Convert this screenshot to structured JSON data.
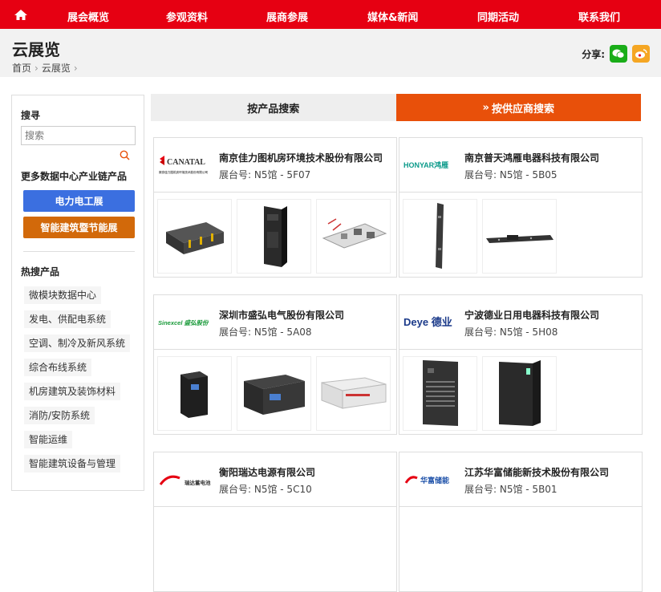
{
  "nav": {
    "items": [
      "展会概览",
      "参观资料",
      "展商参展",
      "媒体&新闻",
      "同期活动",
      "联系我们"
    ]
  },
  "header": {
    "title": "云展览",
    "breadcrumb": [
      "首页",
      "云展览"
    ],
    "share_label": "分享:"
  },
  "sidebar": {
    "search_title": "搜寻",
    "search_placeholder": "搜索",
    "more_title": "更多数据中心产业链产品",
    "buttons": [
      {
        "label": "电力电工展",
        "color": "#3b6fe0"
      },
      {
        "label": "智能建筑暨节能展",
        "color": "#d2690a"
      }
    ],
    "hot_title": "热搜产品",
    "hot_items": [
      "微模块数据中心",
      "发电、供配电系统",
      "空调、制冷及新风系统",
      "综合布线系统",
      "机房建筑及装饰材料",
      "消防/安防系统",
      "智能运维",
      "智能建筑设备与管理"
    ]
  },
  "tabs": {
    "product": "按产品搜索",
    "supplier": "按供应商搜索",
    "supplier_icon": "»"
  },
  "colors": {
    "brand_red": "#e60012",
    "active_tab": "#e8500a"
  },
  "exhibitors": [
    {
      "name": "南京佳力图机房环境技术股份有限公司",
      "booth": "展台号: N5馆 - 5F07",
      "logo": "CANATAL",
      "logo_sub": "南京佳力图机房环境技术股份有限公司"
    },
    {
      "name": "南京普天鸿雁电器科技有限公司",
      "booth": "展台号: N5馆 - 5B05",
      "logo": "HONYAR鸿雁"
    },
    {
      "name": "深圳市盛弘电气股份有限公司",
      "booth": "展台号: N5馆 - 5A08",
      "logo": "Sinexcel 盛弘股份"
    },
    {
      "name": "宁波德业日用电器科技有限公司",
      "booth": "展台号: N5馆 - 5H08",
      "logo": "Deye 德业"
    },
    {
      "name": "衡阳瑞达电源有限公司",
      "booth": "展台号: N5馆 - 5C10",
      "logo": "瑞达蓄电池"
    },
    {
      "name": "江苏华富储能新技术股份有限公司",
      "booth": "展台号: N5馆 - 5B01",
      "logo": "华富储能"
    }
  ]
}
